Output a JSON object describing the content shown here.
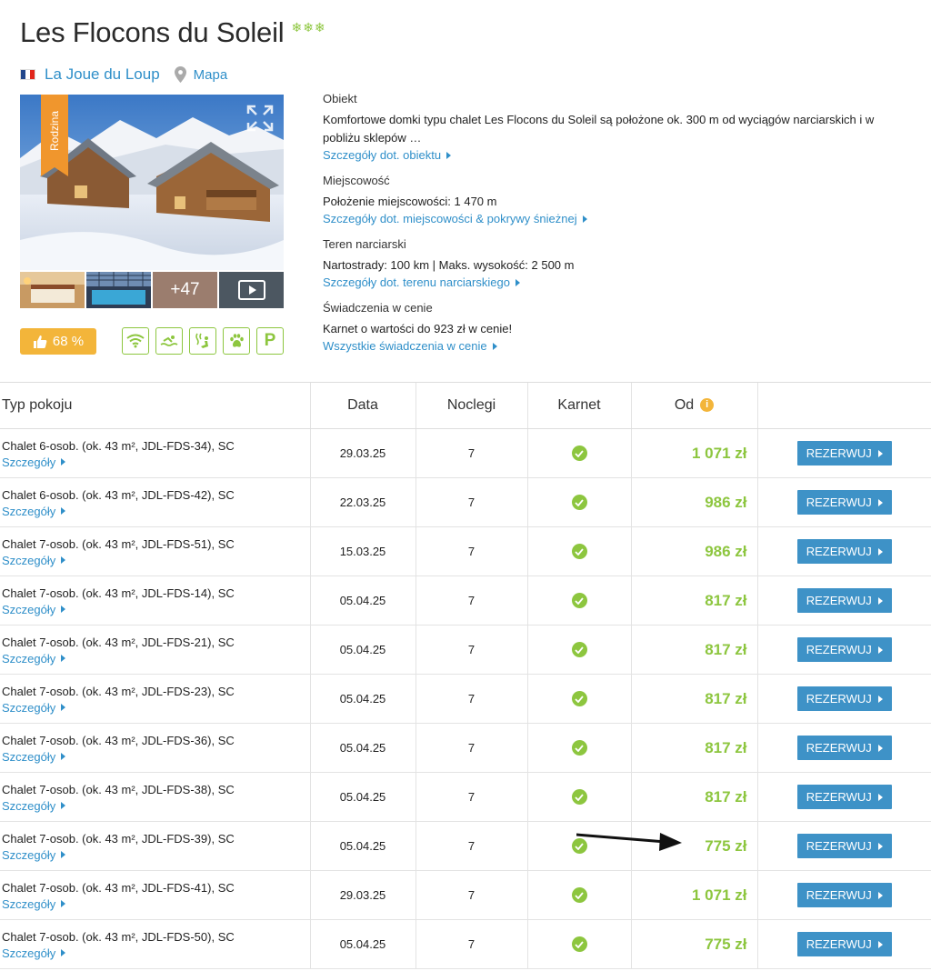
{
  "header": {
    "title": "Les Flocons du Soleil",
    "stars": "❄❄❄",
    "location": "La Joue du Loup",
    "map_label": "Mapa"
  },
  "gallery": {
    "ribbon": "Rodzina",
    "more_photos": "+47"
  },
  "rating": {
    "value": "68 %"
  },
  "amenities": [
    "wifi-icon",
    "pool-icon",
    "sauna-icon",
    "pets-icon",
    "parking-icon"
  ],
  "amenity_parking": "P",
  "info": {
    "object": {
      "heading": "Obiekt",
      "text": "Komfortowe domki typu chalet Les Flocons du Soleil są położone ok. 300 m od wyciągów narciarskich i w pobliżu sklepów …",
      "link": "Szczegóły dot. obiektu"
    },
    "town": {
      "heading": "Miejscowość",
      "text": "Położenie miejscowości: 1 470 m",
      "link": "Szczegóły dot. miejscowości & pokrywy śnieżnej"
    },
    "ski": {
      "heading": "Teren narciarski",
      "text": "Nartostrady: 100 km | Maks. wysokość: 2 500 m",
      "link": "Szczegóły dot. terenu narciarskiego"
    },
    "included": {
      "heading": "Świadczenia w cenie",
      "text": "Karnet o wartości do 923 zł w cenie!",
      "link": "Wszystkie świadczenia w cenie"
    }
  },
  "table": {
    "headers": {
      "type": "Typ pokoju",
      "date": "Data",
      "nights": "Noclegi",
      "pass": "Karnet",
      "from": "Od",
      "from_info": "i"
    },
    "details_label": "Szczegóły",
    "book_label": "REZERWUJ",
    "rows": [
      {
        "name": "Chalet 6-osob. (ok. 43 m², JDL-FDS-34), SC",
        "date": "29.03.25",
        "nights": "7",
        "price": "1 071 zł"
      },
      {
        "name": "Chalet 6-osob. (ok. 43 m², JDL-FDS-42), SC",
        "date": "22.03.25",
        "nights": "7",
        "price": "986 zł"
      },
      {
        "name": "Chalet 7-osob. (ok. 43 m², JDL-FDS-51), SC",
        "date": "15.03.25",
        "nights": "7",
        "price": "986 zł"
      },
      {
        "name": "Chalet 7-osob. (ok. 43 m², JDL-FDS-14), SC",
        "date": "05.04.25",
        "nights": "7",
        "price": "817 zł"
      },
      {
        "name": "Chalet 7-osob. (ok. 43 m², JDL-FDS-21), SC",
        "date": "05.04.25",
        "nights": "7",
        "price": "817 zł"
      },
      {
        "name": "Chalet 7-osob. (ok. 43 m², JDL-FDS-23), SC",
        "date": "05.04.25",
        "nights": "7",
        "price": "817 zł"
      },
      {
        "name": "Chalet 7-osob. (ok. 43 m², JDL-FDS-36), SC",
        "date": "05.04.25",
        "nights": "7",
        "price": "817 zł"
      },
      {
        "name": "Chalet 7-osob. (ok. 43 m², JDL-FDS-38), SC",
        "date": "05.04.25",
        "nights": "7",
        "price": "817 zł"
      },
      {
        "name": "Chalet 7-osob. (ok. 43 m², JDL-FDS-39), SC",
        "date": "05.04.25",
        "nights": "7",
        "price": "775 zł"
      },
      {
        "name": "Chalet 7-osob. (ok. 43 m², JDL-FDS-41), SC",
        "date": "29.03.25",
        "nights": "7",
        "price": "1 071 zł"
      },
      {
        "name": "Chalet 7-osob. (ok. 43 m², JDL-FDS-50), SC",
        "date": "05.04.25",
        "nights": "7",
        "price": "775 zł"
      }
    ]
  },
  "colors": {
    "accent_green": "#8dc63f",
    "link_blue": "#2f8fc9",
    "button_blue": "#3e92c7",
    "rating_orange": "#f3b53a",
    "ribbon_orange": "#f0962d"
  }
}
